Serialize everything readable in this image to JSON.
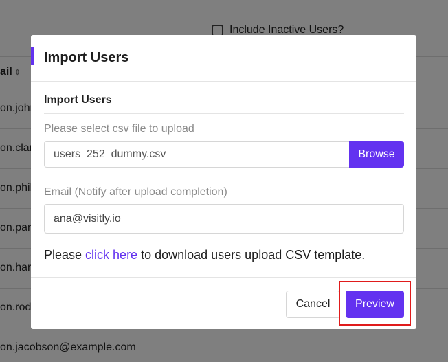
{
  "background": {
    "include_inactive_label": "Include Inactive Users?",
    "email_column_header": "ail",
    "emails": [
      "on.johr",
      "on.clar",
      "on.phil",
      "on.part",
      "on.harr",
      "on.rodr",
      "on.jacobson@example.com"
    ]
  },
  "modal": {
    "title": "Import Users",
    "section_title": "Import Users",
    "file_label": "Please select csv file to upload",
    "file_value": "users_252_dummy.csv",
    "browse_label": "Browse",
    "email_label": "Email (Notify after upload completion)",
    "email_value": "ana@visitly.io",
    "download_prefix": "Please ",
    "download_link": "click here",
    "download_suffix": " to download users upload CSV template.",
    "cancel_label": "Cancel",
    "preview_label": "Preview"
  },
  "colors": {
    "accent": "#6332f0",
    "highlight": "#e01b1b"
  }
}
